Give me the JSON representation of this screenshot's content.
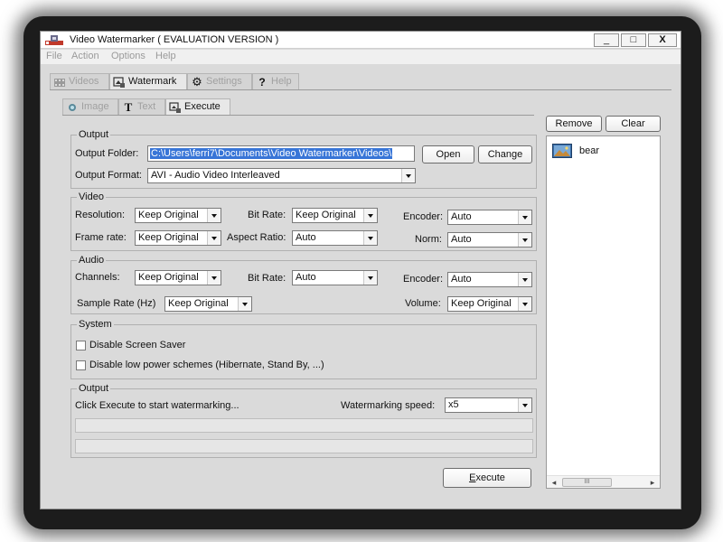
{
  "window": {
    "title": "Video Watermarker ( EVALUATION VERSION )",
    "minimize": "_",
    "maximize": "□",
    "close": "X"
  },
  "menu": {
    "items": [
      "File",
      "Action",
      "Options",
      "Help"
    ]
  },
  "main_tabs": [
    {
      "label": "Videos",
      "icon": "film-icon",
      "active": false
    },
    {
      "label": "Watermark",
      "icon": "watermark-icon",
      "active": true
    },
    {
      "label": "Settings",
      "icon": "gear-icon",
      "active": false
    },
    {
      "label": "Help",
      "icon": "question-icon",
      "active": false
    }
  ],
  "sub_tabs": [
    {
      "label": "Image",
      "icon": "image-icon",
      "active": false
    },
    {
      "label": "Text",
      "icon": "text-icon",
      "active": false
    },
    {
      "label": "Execute",
      "icon": "execute-icon",
      "active": true
    }
  ],
  "output": {
    "group_title": "Output",
    "folder_label": "Output Folder:",
    "folder_value": "C:\\Users\\ferri7\\Documents\\Video Watermarker\\Videos\\",
    "open_button": "Open",
    "change_button": "Change",
    "format_label": "Output Format:",
    "format_value": "AVI - Audio Video Interleaved"
  },
  "video": {
    "group_title": "Video",
    "resolution_label": "Resolution:",
    "resolution_value": "Keep Original",
    "bitrate_label": "Bit Rate:",
    "bitrate_value": "Keep Original",
    "encoder_label": "Encoder:",
    "encoder_value": "Auto",
    "framerate_label": "Frame rate:",
    "framerate_value": "Keep Original",
    "aspect_label": "Aspect Ratio:",
    "aspect_value": "Auto",
    "norm_label": "Norm:",
    "norm_value": "Auto"
  },
  "audio": {
    "group_title": "Audio",
    "channels_label": "Channels:",
    "channels_value": "Keep Original",
    "bitrate_label": "Bit Rate:",
    "bitrate_value": "Auto",
    "encoder_label": "Encoder:",
    "encoder_value": "Auto",
    "samplerate_label": "Sample Rate (Hz)",
    "samplerate_value": "Keep Original",
    "volume_label": "Volume:",
    "volume_value": "Keep Original"
  },
  "system": {
    "group_title": "System",
    "screensaver_label": "Disable Screen Saver",
    "screensaver_checked": false,
    "powerschemes_label": "Disable low power schemes (Hibernate, Stand By, ...)",
    "powerschemes_checked": false
  },
  "progress": {
    "group_title": "Output",
    "status_text": "Click Execute to start watermarking...",
    "speed_label": "Watermarking speed:",
    "speed_value": "x5",
    "bar1_percent": 0,
    "bar2_percent": 0
  },
  "execute_button": {
    "prefix": "E",
    "rest": "xecute"
  },
  "right_panel": {
    "remove_button": "Remove",
    "clear_button": "Clear",
    "items": [
      {
        "label": "bear",
        "icon": "image-file-icon"
      }
    ],
    "scroll_left": "◂",
    "scroll_right": "▸",
    "scroll_thumb": "III"
  }
}
